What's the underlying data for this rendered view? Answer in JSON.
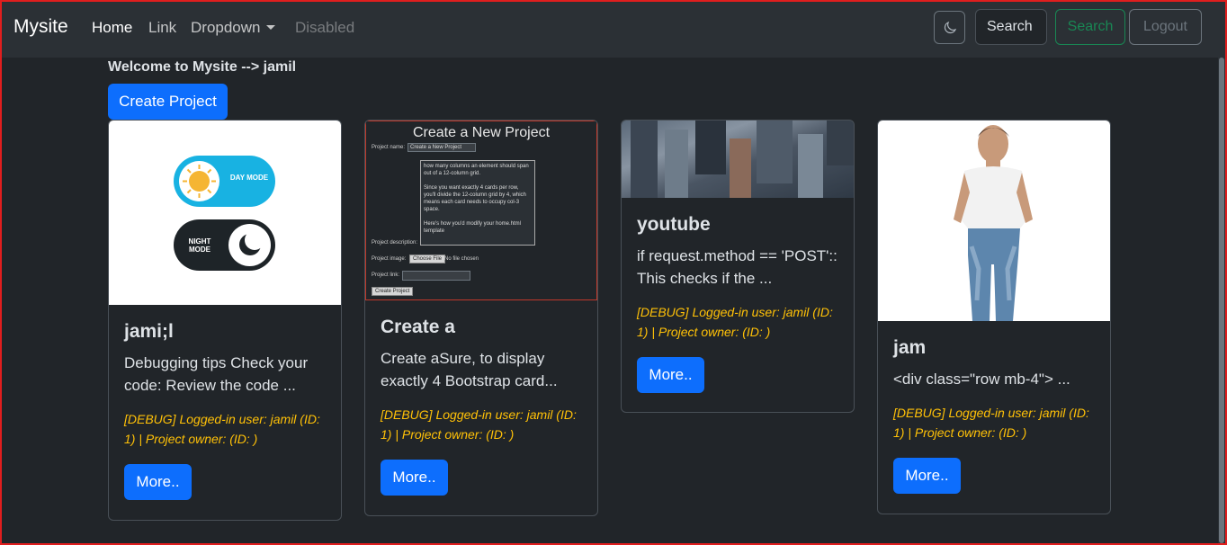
{
  "navbar": {
    "brand": "Mysite",
    "links": [
      {
        "label": "Home",
        "state": "active"
      },
      {
        "label": "Link",
        "state": "normal"
      },
      {
        "label": "Dropdown",
        "state": "normal"
      },
      {
        "label": "Disabled",
        "state": "disabled"
      }
    ],
    "search_value": "Search",
    "search_button": "Search",
    "logout_button": "Logout"
  },
  "welcome": "Welcome to Mysite --> jamil",
  "create_project_button": "Create Project",
  "cards": [
    {
      "title": "jami;l",
      "text": "Debugging tips Check your code: Review the code ...",
      "debug": "[DEBUG] Logged-in user: jamil (ID: 1) | Project owner: (ID: )",
      "button": "More..",
      "image": {
        "day_label": "DAY MODE",
        "night_label": "NIGHT MODE"
      }
    },
    {
      "title": "Create a",
      "text": "Create aSure, to display exactly 4 Bootstrap card...",
      "debug": "[DEBUG] Logged-in user: jamil (ID: 1) | Project owner: (ID: )",
      "button": "More..",
      "image": {
        "heading": "Create a New Project",
        "name_label": "Project name:",
        "name_value": "Create a New Project",
        "desc_label": "Project description:",
        "desc_value": "how many columns an element should span out of a 12-column grid.\n\nSince you want exactly 4 cards per row, you'll divide the 12-column grid by 4, which means each card needs to occupy col-3 space.\n\nHere's how you'd modify your home.html template",
        "image_label": "Project image:",
        "choose_file": "Choose File",
        "no_file": "No file chosen",
        "link_label": "Project link:",
        "submit": "Create Project"
      }
    },
    {
      "title": "youtube",
      "text": "if request.method == 'POST':: This checks if the ...",
      "debug": "[DEBUG] Logged-in user: jamil (ID: 1) | Project owner: (ID: )",
      "button": "More.."
    },
    {
      "title": "jam",
      "text": "<div class=\"row mb-4\"> ...",
      "debug": "[DEBUG] Logged-in user: jamil (ID: 1) | Project owner: (ID: )",
      "button": "More.."
    }
  ],
  "colors": {
    "background": "#212529",
    "navbar": "#2b3035",
    "primary": "#0d6efd",
    "success": "#198754",
    "warning": "#ffc107",
    "border_highlight": "#e01e1e"
  },
  "icons": {
    "theme_toggle": "moon-icon",
    "dropdown": "caret-down-icon"
  }
}
